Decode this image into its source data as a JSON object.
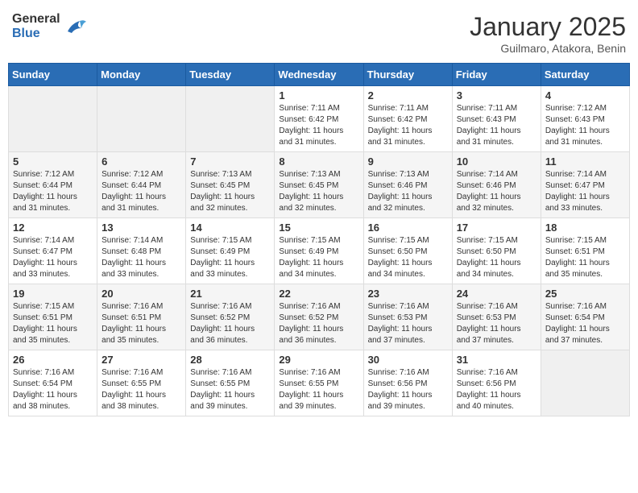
{
  "header": {
    "logo_general": "General",
    "logo_blue": "Blue",
    "month_title": "January 2025",
    "subtitle": "Guilmaro, Atakora, Benin"
  },
  "days_of_week": [
    "Sunday",
    "Monday",
    "Tuesday",
    "Wednesday",
    "Thursday",
    "Friday",
    "Saturday"
  ],
  "weeks": [
    [
      {
        "day": "",
        "info": ""
      },
      {
        "day": "",
        "info": ""
      },
      {
        "day": "",
        "info": ""
      },
      {
        "day": "1",
        "info": "Sunrise: 7:11 AM\nSunset: 6:42 PM\nDaylight: 11 hours and 31 minutes."
      },
      {
        "day": "2",
        "info": "Sunrise: 7:11 AM\nSunset: 6:42 PM\nDaylight: 11 hours and 31 minutes."
      },
      {
        "day": "3",
        "info": "Sunrise: 7:11 AM\nSunset: 6:43 PM\nDaylight: 11 hours and 31 minutes."
      },
      {
        "day": "4",
        "info": "Sunrise: 7:12 AM\nSunset: 6:43 PM\nDaylight: 11 hours and 31 minutes."
      }
    ],
    [
      {
        "day": "5",
        "info": "Sunrise: 7:12 AM\nSunset: 6:44 PM\nDaylight: 11 hours and 31 minutes."
      },
      {
        "day": "6",
        "info": "Sunrise: 7:12 AM\nSunset: 6:44 PM\nDaylight: 11 hours and 31 minutes."
      },
      {
        "day": "7",
        "info": "Sunrise: 7:13 AM\nSunset: 6:45 PM\nDaylight: 11 hours and 32 minutes."
      },
      {
        "day": "8",
        "info": "Sunrise: 7:13 AM\nSunset: 6:45 PM\nDaylight: 11 hours and 32 minutes."
      },
      {
        "day": "9",
        "info": "Sunrise: 7:13 AM\nSunset: 6:46 PM\nDaylight: 11 hours and 32 minutes."
      },
      {
        "day": "10",
        "info": "Sunrise: 7:14 AM\nSunset: 6:46 PM\nDaylight: 11 hours and 32 minutes."
      },
      {
        "day": "11",
        "info": "Sunrise: 7:14 AM\nSunset: 6:47 PM\nDaylight: 11 hours and 33 minutes."
      }
    ],
    [
      {
        "day": "12",
        "info": "Sunrise: 7:14 AM\nSunset: 6:47 PM\nDaylight: 11 hours and 33 minutes."
      },
      {
        "day": "13",
        "info": "Sunrise: 7:14 AM\nSunset: 6:48 PM\nDaylight: 11 hours and 33 minutes."
      },
      {
        "day": "14",
        "info": "Sunrise: 7:15 AM\nSunset: 6:49 PM\nDaylight: 11 hours and 33 minutes."
      },
      {
        "day": "15",
        "info": "Sunrise: 7:15 AM\nSunset: 6:49 PM\nDaylight: 11 hours and 34 minutes."
      },
      {
        "day": "16",
        "info": "Sunrise: 7:15 AM\nSunset: 6:50 PM\nDaylight: 11 hours and 34 minutes."
      },
      {
        "day": "17",
        "info": "Sunrise: 7:15 AM\nSunset: 6:50 PM\nDaylight: 11 hours and 34 minutes."
      },
      {
        "day": "18",
        "info": "Sunrise: 7:15 AM\nSunset: 6:51 PM\nDaylight: 11 hours and 35 minutes."
      }
    ],
    [
      {
        "day": "19",
        "info": "Sunrise: 7:15 AM\nSunset: 6:51 PM\nDaylight: 11 hours and 35 minutes."
      },
      {
        "day": "20",
        "info": "Sunrise: 7:16 AM\nSunset: 6:51 PM\nDaylight: 11 hours and 35 minutes."
      },
      {
        "day": "21",
        "info": "Sunrise: 7:16 AM\nSunset: 6:52 PM\nDaylight: 11 hours and 36 minutes."
      },
      {
        "day": "22",
        "info": "Sunrise: 7:16 AM\nSunset: 6:52 PM\nDaylight: 11 hours and 36 minutes."
      },
      {
        "day": "23",
        "info": "Sunrise: 7:16 AM\nSunset: 6:53 PM\nDaylight: 11 hours and 37 minutes."
      },
      {
        "day": "24",
        "info": "Sunrise: 7:16 AM\nSunset: 6:53 PM\nDaylight: 11 hours and 37 minutes."
      },
      {
        "day": "25",
        "info": "Sunrise: 7:16 AM\nSunset: 6:54 PM\nDaylight: 11 hours and 37 minutes."
      }
    ],
    [
      {
        "day": "26",
        "info": "Sunrise: 7:16 AM\nSunset: 6:54 PM\nDaylight: 11 hours and 38 minutes."
      },
      {
        "day": "27",
        "info": "Sunrise: 7:16 AM\nSunset: 6:55 PM\nDaylight: 11 hours and 38 minutes."
      },
      {
        "day": "28",
        "info": "Sunrise: 7:16 AM\nSunset: 6:55 PM\nDaylight: 11 hours and 39 minutes."
      },
      {
        "day": "29",
        "info": "Sunrise: 7:16 AM\nSunset: 6:55 PM\nDaylight: 11 hours and 39 minutes."
      },
      {
        "day": "30",
        "info": "Sunrise: 7:16 AM\nSunset: 6:56 PM\nDaylight: 11 hours and 39 minutes."
      },
      {
        "day": "31",
        "info": "Sunrise: 7:16 AM\nSunset: 6:56 PM\nDaylight: 11 hours and 40 minutes."
      },
      {
        "day": "",
        "info": ""
      }
    ]
  ]
}
